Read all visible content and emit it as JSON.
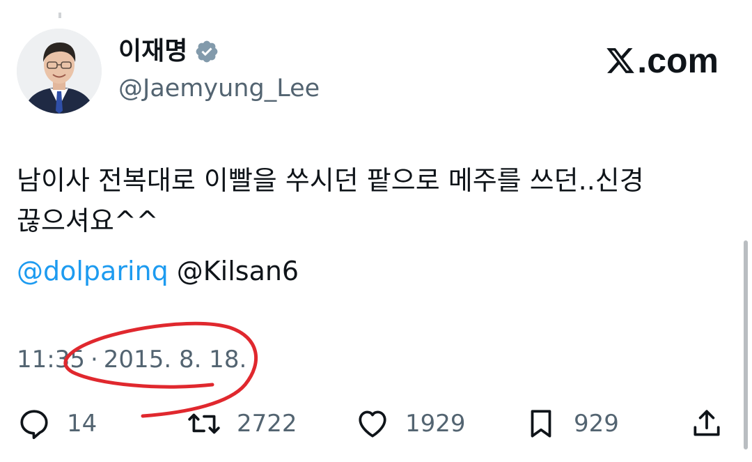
{
  "author": {
    "display_name": "이재명",
    "handle": "@Jaemyung_Lee",
    "verified_icon": "verified-badge-icon"
  },
  "brand": {
    "text": ".com",
    "logo": "x-logo-icon"
  },
  "tweet": {
    "text": "남이사 전복대로 이빨을 쑤시던 팥으로 메주를 쓰던..신경\n끊으셔요^^",
    "mentions": [
      "@dolparinq",
      "@Kilsan6"
    ],
    "time": "11:35",
    "separator": "·",
    "date": "2015. 8. 18."
  },
  "actions": {
    "reply_count": "14",
    "retweet_count": "2722",
    "like_count": "1929",
    "bookmark_count": "929",
    "icons": [
      "reply-icon",
      "retweet-icon",
      "like-icon",
      "bookmark-icon",
      "share-icon"
    ]
  },
  "colors": {
    "text": "#0f1419",
    "secondary": "#536471",
    "link": "#1d9bf0",
    "annotation": "#e0282e"
  }
}
